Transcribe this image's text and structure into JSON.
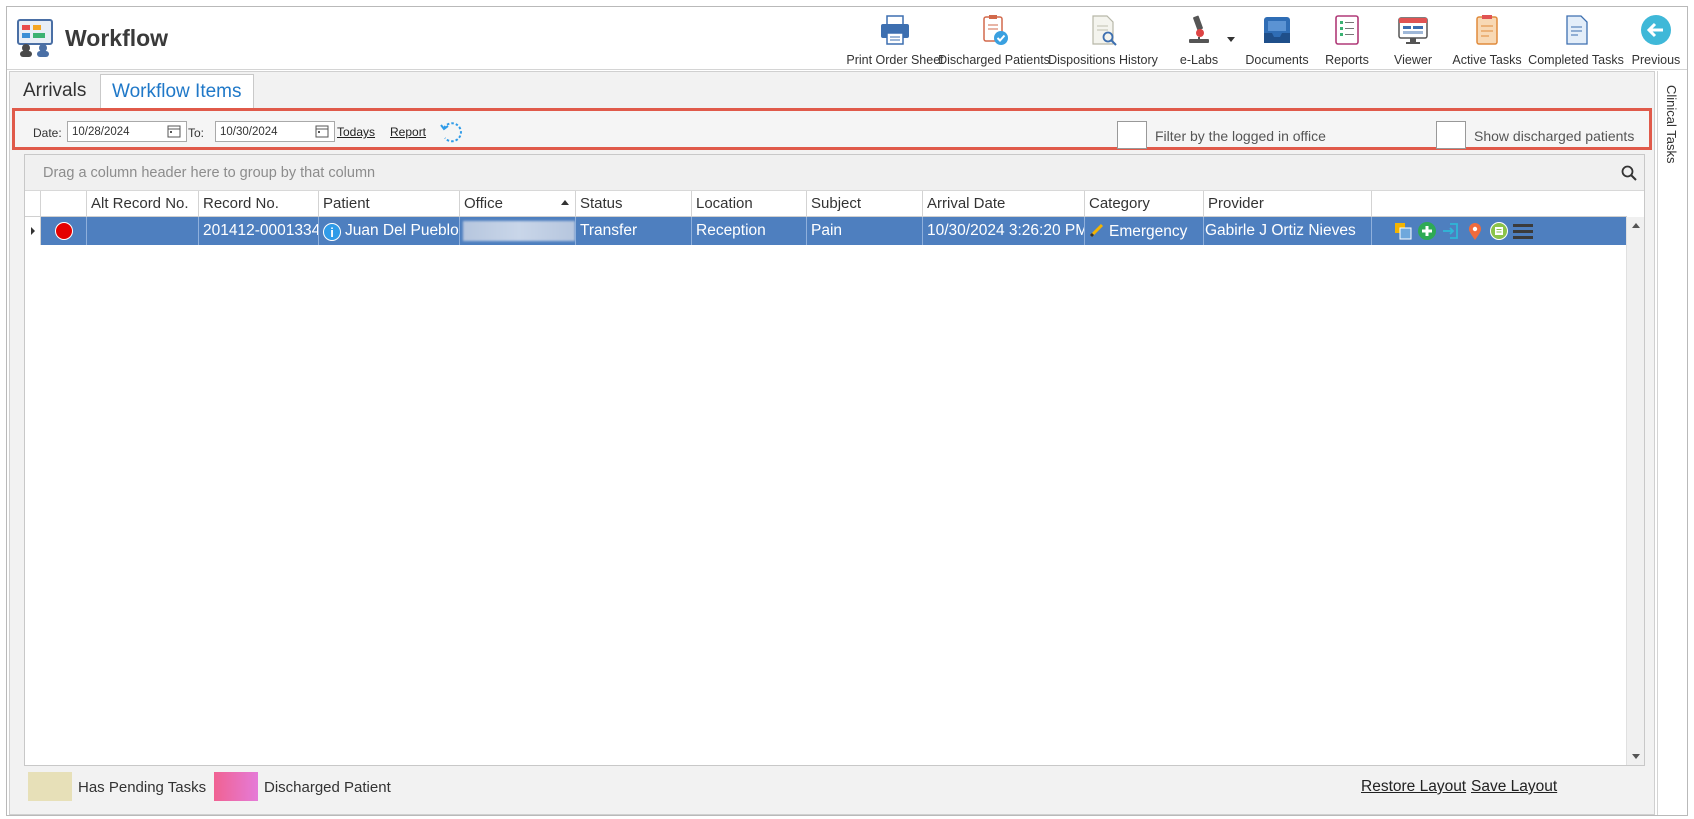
{
  "app": {
    "title": "Workflow"
  },
  "toolbar": {
    "buttons": [
      {
        "label": "Print Order Sheet",
        "icon": "printer-icon"
      },
      {
        "label": "Discharged Patients",
        "icon": "clipboard-check-icon"
      },
      {
        "label": "Dispositions History",
        "icon": "document-search-icon"
      },
      {
        "label": "e-Labs",
        "icon": "microscope-icon"
      },
      {
        "label": "Documents",
        "icon": "inbox-tray-icon"
      },
      {
        "label": "Reports",
        "icon": "report-list-icon"
      },
      {
        "label": "Viewer",
        "icon": "monitor-icon"
      },
      {
        "label": "Active Tasks",
        "icon": "task-clipboard-icon"
      },
      {
        "label": "Completed Tasks",
        "icon": "completed-doc-icon"
      },
      {
        "label": "Previous",
        "icon": "back-arrow-icon"
      }
    ]
  },
  "right_rail": {
    "label": "Clinical Tasks"
  },
  "tabs": {
    "arrivals": "Arrivals",
    "workflow_items": "Workflow Items"
  },
  "filter": {
    "date_label": "Date:",
    "date_from": "10/28/2024",
    "to_label": "To:",
    "date_to": "10/30/2024",
    "todays_link": "Todays",
    "report_link": "Report",
    "filter_office_label": "Filter by the logged in office",
    "show_discharged_label": "Show discharged patients"
  },
  "grid": {
    "group_hint": "Drag a column header here to group by that column",
    "columns": {
      "alt_record": "Alt Record No.",
      "record": "Record No.",
      "patient": "Patient",
      "office": "Office",
      "status": "Status",
      "location": "Location",
      "subject": "Subject",
      "arrival_date": "Arrival Date",
      "category": "Category",
      "provider": "Provider"
    },
    "rows": [
      {
        "alt_record": "",
        "record": "201412-0001334",
        "patient": "Juan Del Pueblo",
        "status": "Transfer",
        "location": "Reception",
        "subject": "Pain",
        "arrival_date": "10/30/2024 3:26:20 PM",
        "category": "Emergency",
        "provider": "Gabirle J Ortiz Nieves"
      }
    ]
  },
  "legend": {
    "pending": "Has Pending Tasks",
    "discharged": "Discharged Patient"
  },
  "footer": {
    "restore_layout": "Restore Layout",
    "save_layout": "Save Layout"
  },
  "colors": {
    "accent": "#1f78c8",
    "selected_row": "#4e7fbf",
    "highlight_border": "#e05a4a",
    "pending": "#e7e0b8",
    "discharged": "#f06292"
  }
}
